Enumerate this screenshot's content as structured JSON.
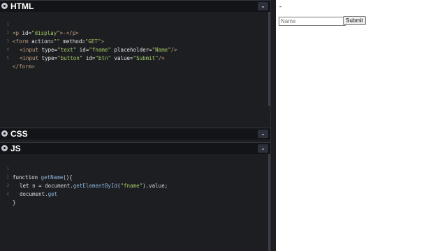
{
  "panels": {
    "html": {
      "title": "HTML"
    },
    "css": {
      "title": "CSS"
    },
    "js": {
      "title": "JS"
    }
  },
  "icons": {
    "collapse": "chevron-down-icon",
    "settings": "gear-icon"
  },
  "colors": {
    "editor_bg": "#1d1e22",
    "header_bg": "#131417",
    "tag": "#c3a07a",
    "string": "#a6c965"
  },
  "html_code": {
    "line_numbers": [
      "1",
      "2",
      "3",
      "4",
      "5"
    ],
    "l1": {
      "open": "<p ",
      "attr": "id=",
      "val": "\"display\"",
      "close": ">-</p>"
    },
    "l2": {
      "open": "<form ",
      "a1": "action=",
      "v1": "\"\"",
      "a2": " method=",
      "v2": "\"GET\"",
      "close": ">"
    },
    "l3": {
      "open": "<input ",
      "a1": "type=",
      "v1": "\"text\"",
      "a2": " id=",
      "v2": "\"fname\"",
      "a3": " placeholder=",
      "v3": "\"Name\"",
      "close": "/>"
    },
    "l4": {
      "open": "<input ",
      "a1": "type=",
      "v1": "\"button\"",
      "a2": " id=",
      "v2": "\"btn\"",
      "a3": " value=",
      "v3": "\"Submit\"",
      "close": "/>"
    },
    "l5": {
      "close": "</form>"
    }
  },
  "js_code": {
    "line_numbers": [
      "1",
      "2",
      "3",
      "4"
    ],
    "l1": {
      "kw": "function ",
      "fn": "getName",
      "rest": "(){"
    },
    "l2": {
      "kw": "let ",
      "var": "n = document.",
      "fn": "getElementById",
      "open": "(",
      "str": "\"fname\"",
      "rest": ").value;"
    },
    "l3": {
      "var": "document.",
      "fn": "get"
    },
    "l4": {
      "rest": "}"
    }
  },
  "preview": {
    "display_text": "-",
    "input_placeholder": "Name",
    "button_label": "Submit"
  }
}
